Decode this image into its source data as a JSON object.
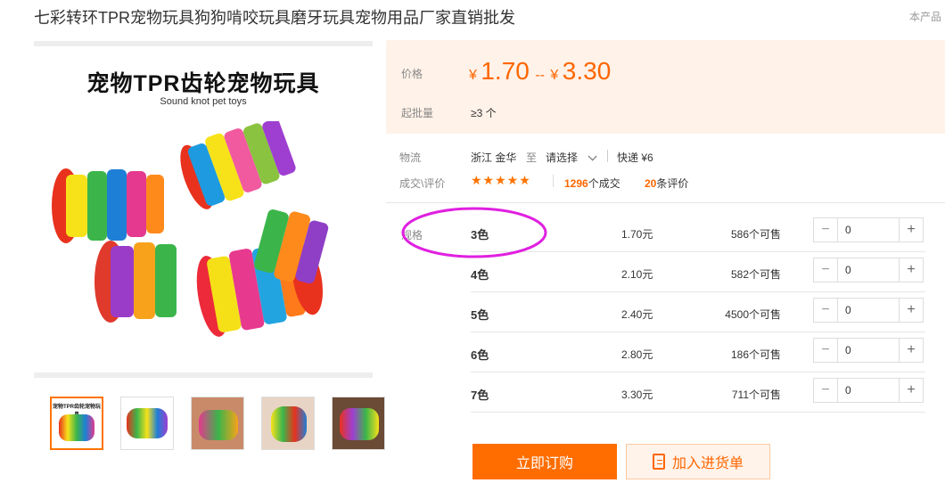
{
  "product": {
    "title": "七彩转环TPR宠物玩具狗狗啃咬玩具磨牙玩具宠物用品厂家直销批发",
    "corner_note": "本产品"
  },
  "main_image": {
    "heading": "宠物TPR齿轮宠物玩具",
    "subheading": "Sound knot pet toys"
  },
  "thumbnails": [
    {
      "caption": "宠物TPR齿轮宠物玩具"
    },
    {
      "caption": ""
    },
    {
      "caption": ""
    },
    {
      "caption": ""
    },
    {
      "caption": ""
    }
  ],
  "price": {
    "label": "价格",
    "currency": "¥",
    "low": "1.70",
    "sep": "--",
    "high": "3.30",
    "moq_label": "起批量",
    "moq_value": "≥3 个"
  },
  "logistics": {
    "label": "物流",
    "origin": "浙江 金华",
    "to": "至",
    "dest": "请选择",
    "express": "快递 ¥6"
  },
  "reviews": {
    "label": "成交\\评价",
    "stars": "★★★★★",
    "deals_num": "1296",
    "deals_unit": "个成交",
    "review_num": "20",
    "review_unit": "条评价"
  },
  "sku": {
    "label": "规格",
    "rows": [
      {
        "name": "3色",
        "price": "1.70元",
        "stock": "586个可售",
        "qty": "0"
      },
      {
        "name": "4色",
        "price": "2.10元",
        "stock": "582个可售",
        "qty": "0"
      },
      {
        "name": "5色",
        "price": "2.40元",
        "stock": "4500个可售",
        "qty": "0"
      },
      {
        "name": "6色",
        "price": "2.80元",
        "stock": "186个可售",
        "qty": "0"
      },
      {
        "name": "7色",
        "price": "3.30元",
        "stock": "711个可售",
        "qty": "0"
      }
    ]
  },
  "actions": {
    "order": "立即订购",
    "cart": "加入进货单"
  },
  "colors": {
    "accent": "#ff6600",
    "annotation": "#e020e0"
  }
}
